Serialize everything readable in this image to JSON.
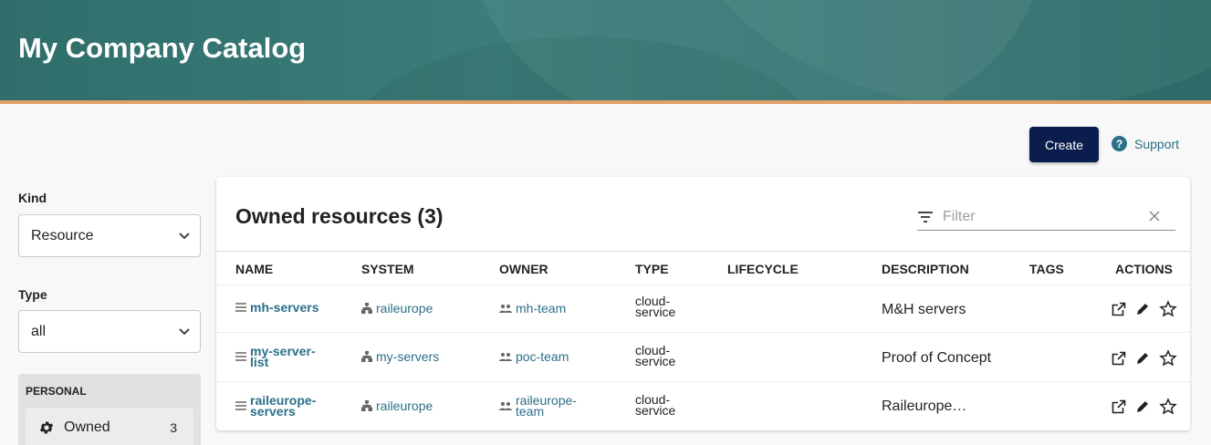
{
  "header": {
    "title": "My Company Catalog"
  },
  "toolbar": {
    "create_label": "Create",
    "support_label": "Support"
  },
  "sidebar": {
    "kind_label": "Kind",
    "kind_value": "Resource",
    "type_label": "Type",
    "type_value": "all",
    "personal_label": "PERSONAL",
    "owned_label": "Owned",
    "owned_count": "3"
  },
  "table": {
    "title": "Owned resources (3)",
    "filter_placeholder": "Filter",
    "columns": [
      "NAME",
      "SYSTEM",
      "OWNER",
      "TYPE",
      "LIFECYCLE",
      "DESCRIPTION",
      "TAGS",
      "ACTIONS"
    ],
    "rows": [
      {
        "name_l1": "mh-servers",
        "name_l2": "",
        "system": "raileurope",
        "owner_l1": "mh-team",
        "owner_l2": "",
        "type_l1": "cloud-",
        "type_l2": "service",
        "lifecycle": "",
        "description": "M&H servers",
        "tags": ""
      },
      {
        "name_l1": "my-server-",
        "name_l2": "list",
        "system": "my-servers",
        "owner_l1": "poc-team",
        "owner_l2": "",
        "type_l1": "cloud-",
        "type_l2": "service",
        "lifecycle": "",
        "description": "Proof of Concept",
        "tags": ""
      },
      {
        "name_l1": "raileurope-",
        "name_l2": "servers",
        "system": "raileurope",
        "owner_l1": "raileurope-",
        "owner_l2": "team",
        "type_l1": "cloud-",
        "type_l2": "service",
        "lifecycle": "",
        "description": "Raileurope…",
        "tags": ""
      }
    ]
  },
  "icons": {
    "name": "list-icon",
    "system": "system-icon",
    "owner": "group-icon",
    "open": "open-in-new-icon",
    "edit": "edit-icon",
    "star": "star-outline-icon"
  },
  "colors": {
    "header": "#347472",
    "accent_stripe": "#e0a06b",
    "create_button": "#0b1d4c",
    "link": "#2b6f88"
  }
}
